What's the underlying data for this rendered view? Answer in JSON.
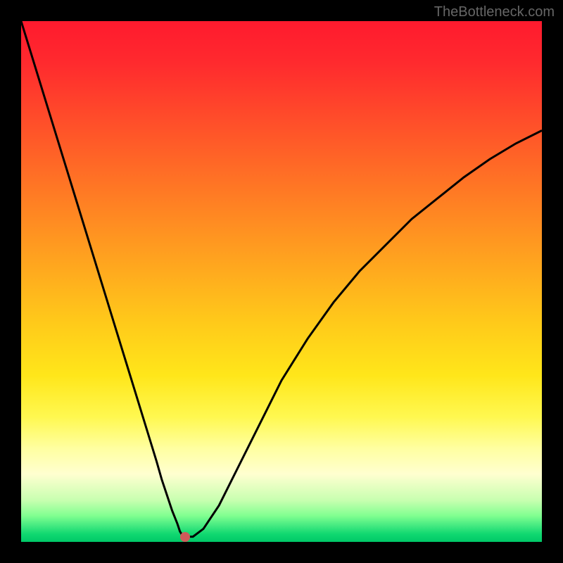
{
  "watermark": "TheBottleneck.com",
  "chart_data": {
    "type": "line",
    "title": "",
    "xlabel": "",
    "ylabel": "",
    "x": [
      0,
      2,
      4,
      6,
      8,
      10,
      12,
      14,
      16,
      18,
      20,
      22,
      24,
      26,
      27,
      28,
      29,
      30,
      30.5,
      31,
      31.5,
      32,
      33,
      35,
      38,
      42,
      46,
      50,
      55,
      60,
      65,
      70,
      75,
      80,
      85,
      90,
      95,
      100
    ],
    "y": [
      100,
      93.5,
      87,
      80.5,
      74,
      67.5,
      61,
      54.5,
      48,
      41.5,
      35,
      28.5,
      22,
      15.5,
      12,
      9,
      6,
      3.5,
      2,
      1.2,
      1,
      1,
      1,
      2.5,
      7,
      15,
      23,
      31,
      39,
      46,
      52,
      57,
      62,
      66,
      70,
      73.5,
      76.5,
      79
    ],
    "xlim": [
      0,
      100
    ],
    "ylim": [
      0,
      100
    ],
    "marker": {
      "x": 31.5,
      "y": 1
    },
    "colors": {
      "curve": "#000000",
      "marker": "#d05a5a",
      "gradient_top": "#ff1a2e",
      "gradient_bottom": "#00c868"
    }
  }
}
